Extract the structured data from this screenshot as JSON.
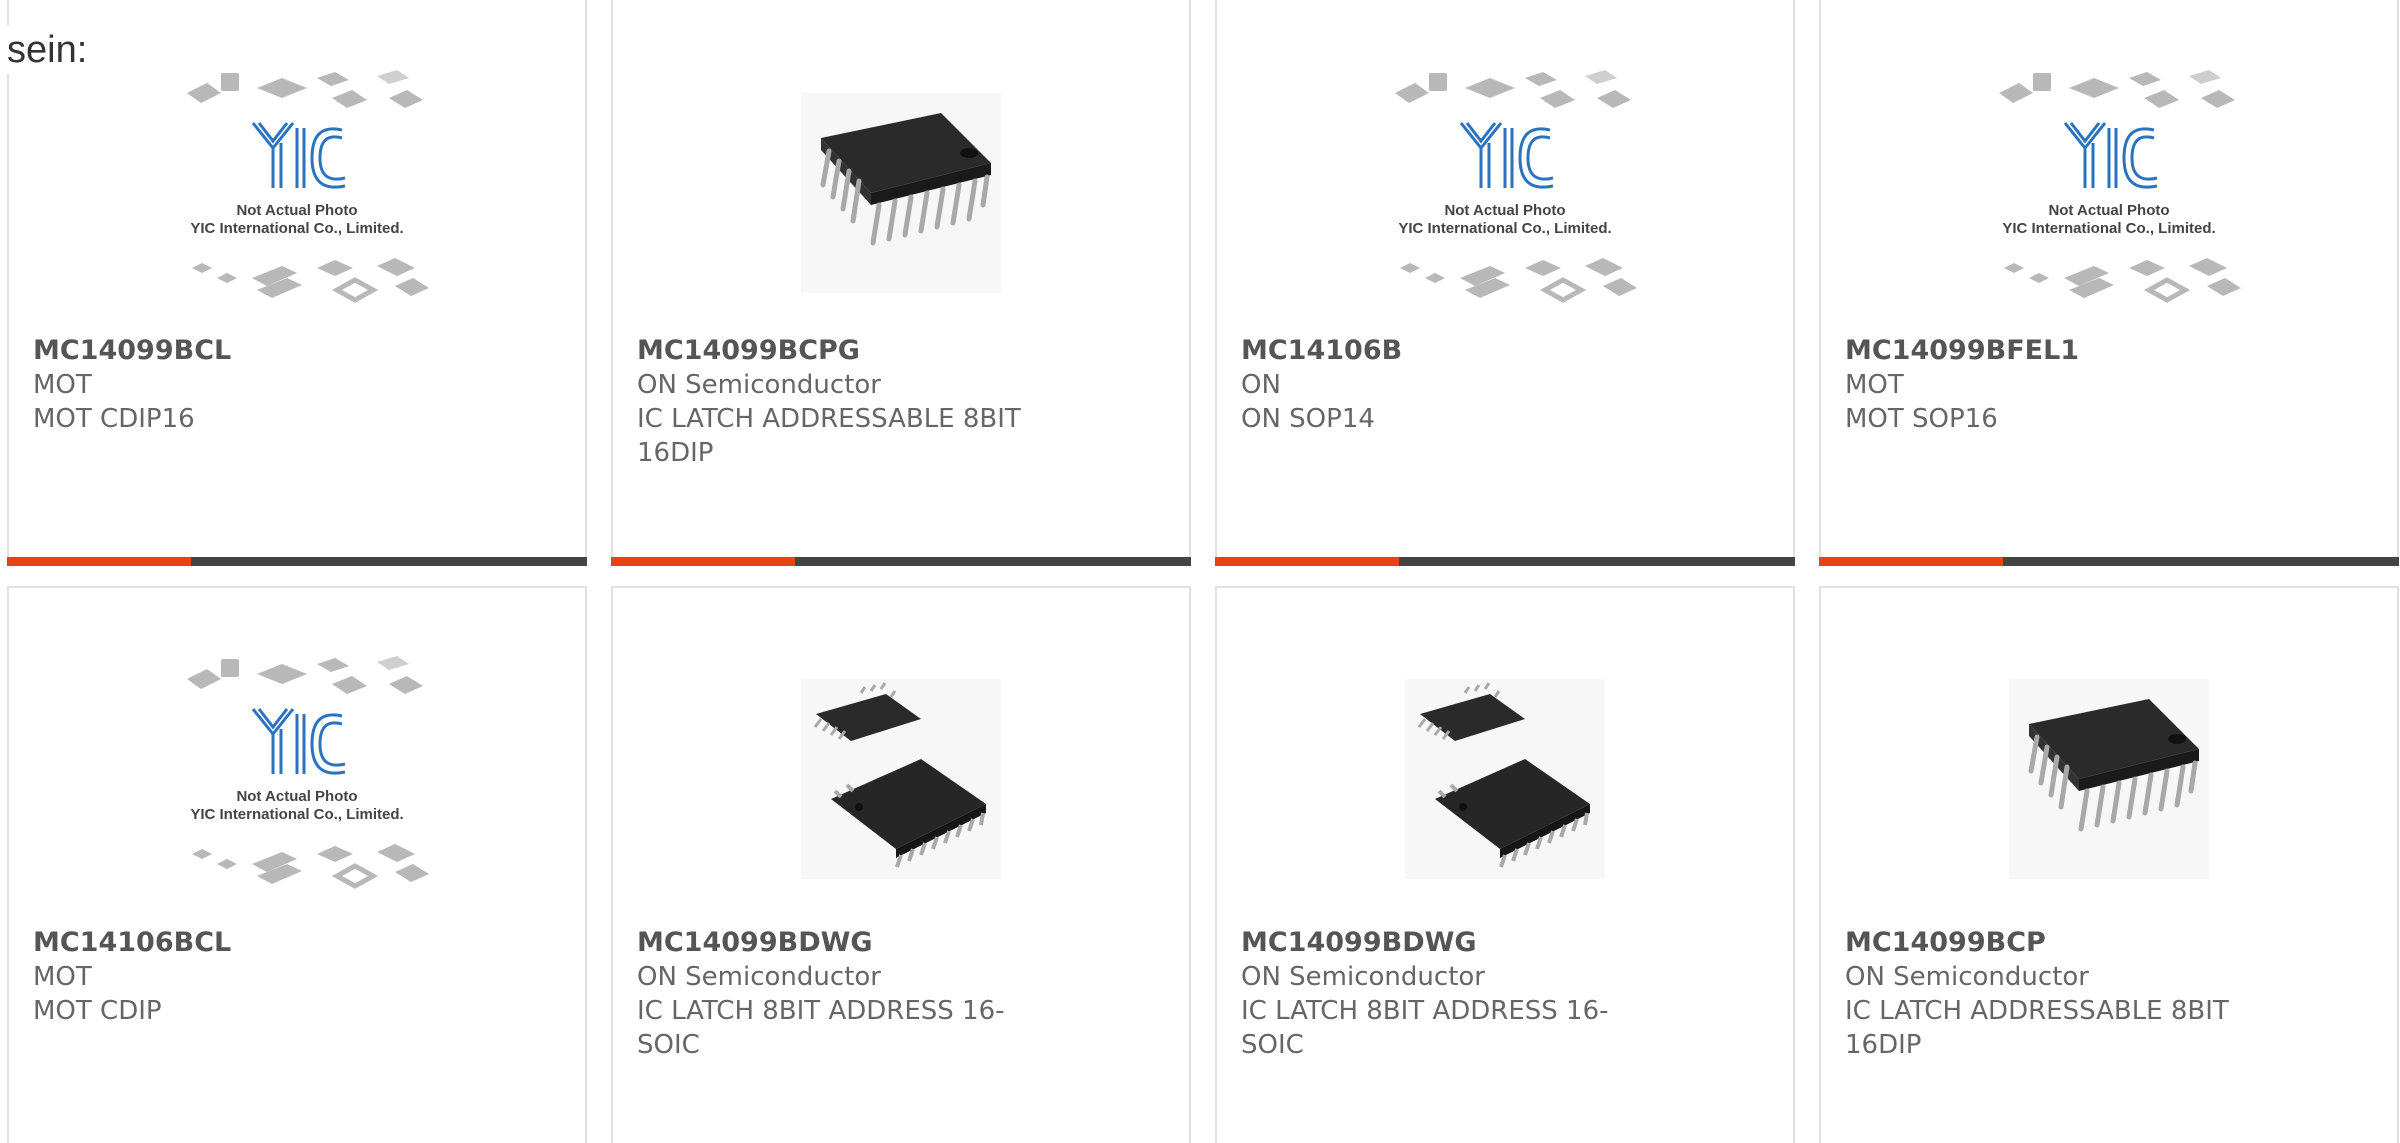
{
  "intro_text": "sein:",
  "placeholder": {
    "logo_text": "YIC",
    "line1": "Not Actual Photo",
    "line2": "YIC International Co., Limited."
  },
  "colors": {
    "accent": "#e8420e",
    "bar": "#444444",
    "border": "#e2e2e2"
  },
  "products": [
    {
      "part": "MC14099BCL",
      "maker": "MOT",
      "desc": "MOT CDIP16",
      "image": "placeholder"
    },
    {
      "part": "MC14099BCPG",
      "maker": "ON Semiconductor",
      "desc": "IC LATCH ADDRESSABLE 8BIT 16DIP",
      "image": "dip16-chip"
    },
    {
      "part": "MC14106B",
      "maker": "ON",
      "desc": "ON SOP14",
      "image": "placeholder"
    },
    {
      "part": "MC14099BFEL1",
      "maker": "MOT",
      "desc": "MOT SOP16",
      "image": "placeholder"
    },
    {
      "part": "MC14106BCL",
      "maker": "MOT",
      "desc": "MOT CDIP",
      "image": "placeholder"
    },
    {
      "part": "MC14099BDWG",
      "maker": "ON Semiconductor",
      "desc": "IC LATCH 8BIT ADDRESS 16-SOIC",
      "image": "soic16-chips"
    },
    {
      "part": "MC14099BDWG",
      "maker": "ON Semiconductor",
      "desc": "IC LATCH 8BIT ADDRESS 16-SOIC",
      "image": "soic16-chips"
    },
    {
      "part": "MC14099BCP",
      "maker": "ON Semiconductor",
      "desc": "IC LATCH ADDRESSABLE 8BIT 16DIP",
      "image": "dip16-chip"
    }
  ]
}
